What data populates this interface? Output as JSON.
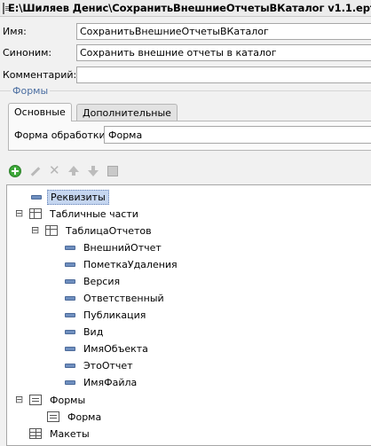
{
  "window": {
    "title": "E:\\Шиляев Денис\\СохранитьВнешниеОтчетыВКаталог v1.1.epf"
  },
  "fields": {
    "name_label": "Имя:",
    "name_value": "СохранитьВнешниеОтчетыВКаталог",
    "synonym_label": "Синоним:",
    "synonym_value": "Сохранить внешние отчеты в каталог",
    "comment_label": "Комментарий:",
    "comment_value": ""
  },
  "forms_group": {
    "title": "Формы",
    "tabs": [
      {
        "label": "Основные",
        "active": true
      },
      {
        "label": "Дополнительные",
        "active": false
      }
    ],
    "processing_form_label": "Форма обработки:",
    "processing_form_value": "Форма"
  },
  "toolbar": {
    "buttons": [
      "add-icon",
      "pencil-icon",
      "delete-icon",
      "move-up-icon",
      "move-down-icon",
      "properties-icon"
    ]
  },
  "tree": {
    "requisites": "Реквизиты",
    "tabular_parts": "Табличные части",
    "reports_table": "ТаблицаОтчетов",
    "columns": [
      "ВнешнийОтчет",
      "ПометкаУдаления",
      "Версия",
      "Ответственный",
      "Публикация",
      "Вид",
      "ИмяОбъекта",
      "ЭтоОтчет",
      "ИмяФайла"
    ],
    "forms": "Формы",
    "form_item": "Форма",
    "layouts": "Макеты",
    "expand_minus": "⊟"
  },
  "colors": {
    "selection": "#c5d6f0",
    "group_title": "#4b6ea1",
    "add_green": "#3ea83a"
  }
}
